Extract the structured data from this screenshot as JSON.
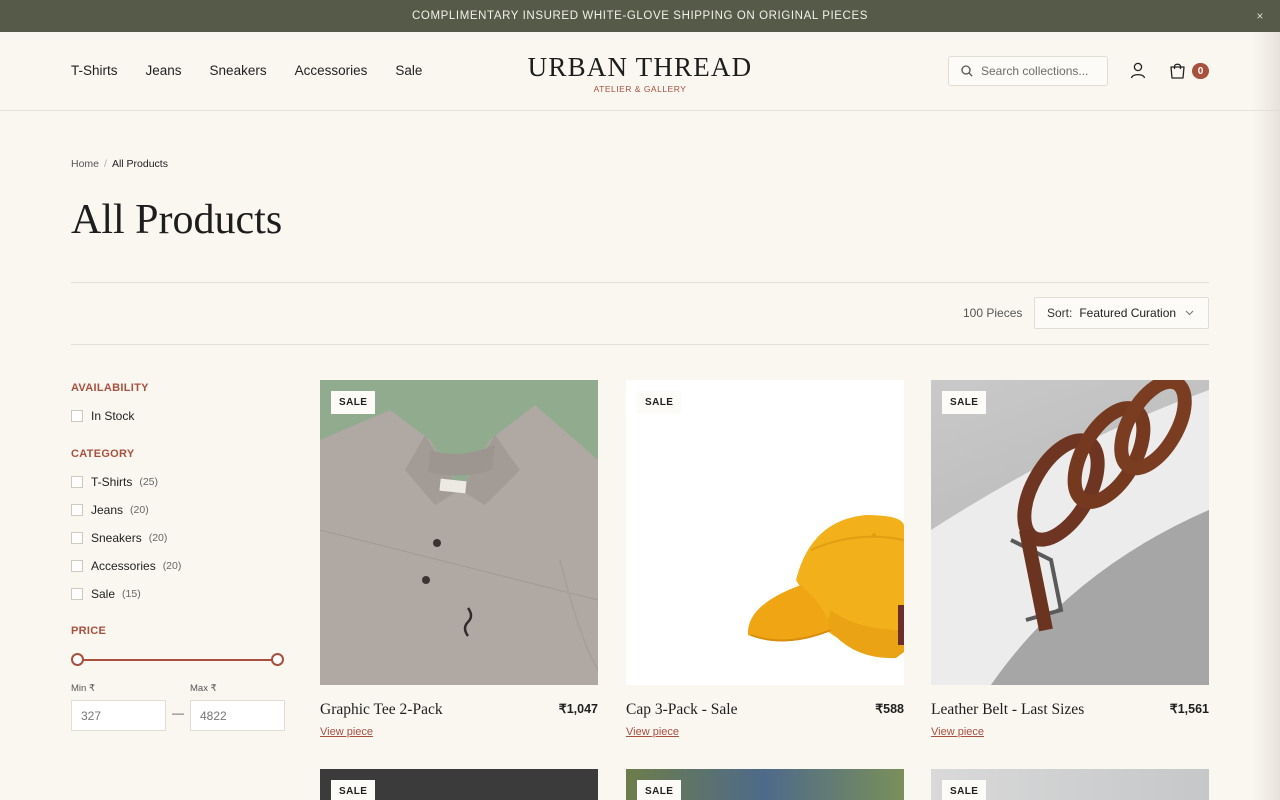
{
  "announcement": {
    "text": "COMPLIMENTARY INSURED WHITE-GLOVE SHIPPING ON ORIGINAL PIECES",
    "close": "×"
  },
  "nav": [
    "T-Shirts",
    "Jeans",
    "Sneakers",
    "Accessories",
    "Sale"
  ],
  "logo": {
    "brand": "URBAN THREAD",
    "sub": "ATELIER & GALLERY"
  },
  "search": {
    "placeholder": "Search collections..."
  },
  "cart": {
    "count": "0"
  },
  "breadcrumb": {
    "home": "Home",
    "separator": "/",
    "current": "All Products"
  },
  "page_title": "All Products",
  "toolbar": {
    "count": "100 Pieces",
    "sort_label": "Sort:",
    "sort_value": "Featured Curation"
  },
  "filters": {
    "availability": {
      "heading": "AVAILABILITY",
      "options": [
        {
          "label": "In Stock"
        }
      ]
    },
    "category": {
      "heading": "CATEGORY",
      "options": [
        {
          "label": "T-Shirts",
          "count": "(25)"
        },
        {
          "label": "Jeans",
          "count": "(20)"
        },
        {
          "label": "Sneakers",
          "count": "(20)"
        },
        {
          "label": "Accessories",
          "count": "(20)"
        },
        {
          "label": "Sale",
          "count": "(15)"
        }
      ]
    },
    "price": {
      "heading": "PRICE",
      "min_label": "Min ₹",
      "max_label": "Max ₹",
      "min_value": "327",
      "max_value": "4822",
      "dash": "—"
    }
  },
  "products": [
    {
      "badge": "SALE",
      "name": "Graphic Tee 2-Pack",
      "price": "₹1,047",
      "link": "View piece"
    },
    {
      "badge": "SALE",
      "name": "Cap 3-Pack - Sale",
      "price": "₹588",
      "link": "View piece"
    },
    {
      "badge": "SALE",
      "name": "Leather Belt - Last Sizes",
      "price": "₹1,561",
      "link": "View piece"
    }
  ],
  "more_products": [
    {
      "badge": "SALE"
    },
    {
      "badge": "SALE"
    },
    {
      "badge": "SALE"
    }
  ],
  "colors": {
    "accent": "#a8503e",
    "banner": "#555b48",
    "background": "#faf7f1"
  }
}
